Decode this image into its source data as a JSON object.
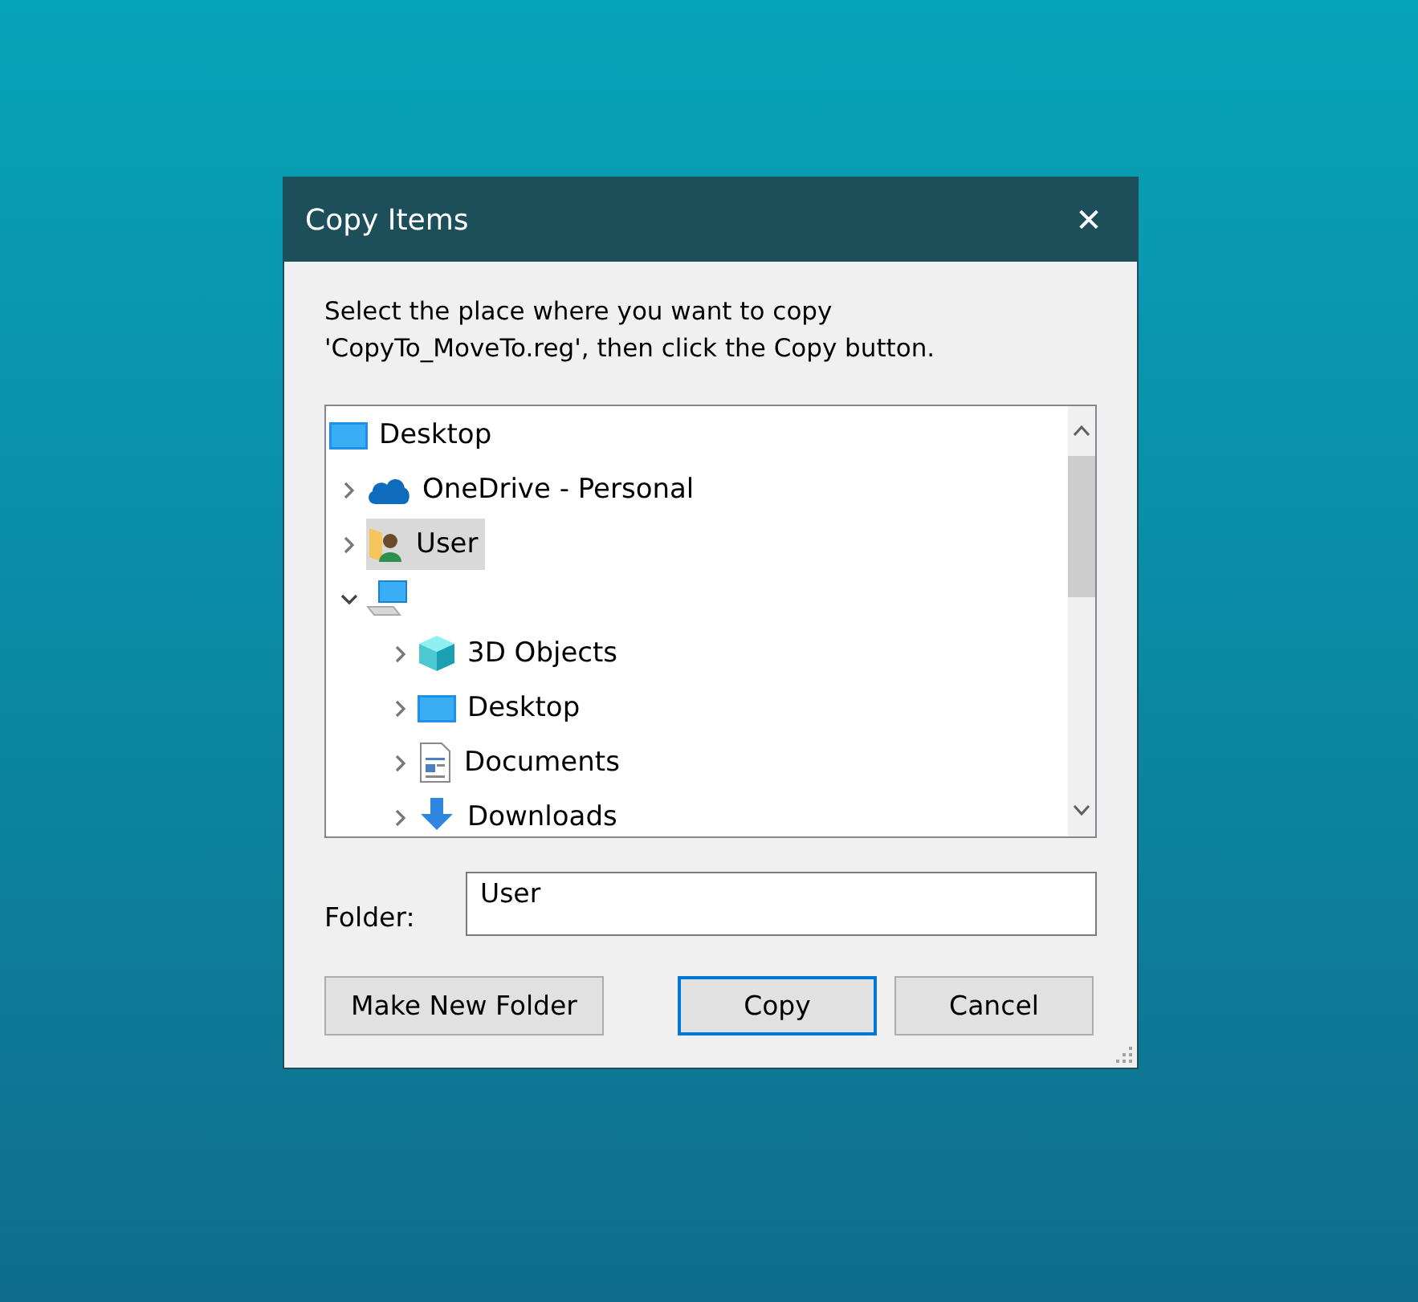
{
  "window": {
    "title": "Copy Items",
    "close": "✕"
  },
  "instructions": "Select the place where you want to copy 'CopyTo_MoveTo.reg', then click the Copy button.",
  "tree": [
    {
      "label": "Desktop",
      "kind": "desktop",
      "selected": false,
      "children": [
        {
          "label": "OneDrive - Personal",
          "kind": "cloud",
          "selected": false,
          "expanded": false
        },
        {
          "label": "User",
          "kind": "user-folder",
          "selected": true,
          "expanded": false
        },
        {
          "kind": "computer",
          "selected": false,
          "expanded": true,
          "children": [
            {
              "label": "3D Objects",
              "kind": "cube",
              "selected": false,
              "expanded": false
            },
            {
              "label": "Desktop",
              "kind": "desktop",
              "selected": false,
              "expanded": false
            },
            {
              "label": "Documents",
              "kind": "document",
              "selected": false,
              "expanded": false
            },
            {
              "label": "Downloads",
              "kind": "download",
              "selected": false,
              "expanded": false
            }
          ]
        }
      ]
    }
  ],
  "folder": {
    "label": "Folder:",
    "value": "User"
  },
  "buttons": [
    {
      "label": "Make New Folder",
      "default": false
    },
    {
      "label": "Copy",
      "default": true
    },
    {
      "label": "Cancel",
      "default": false
    }
  ]
}
